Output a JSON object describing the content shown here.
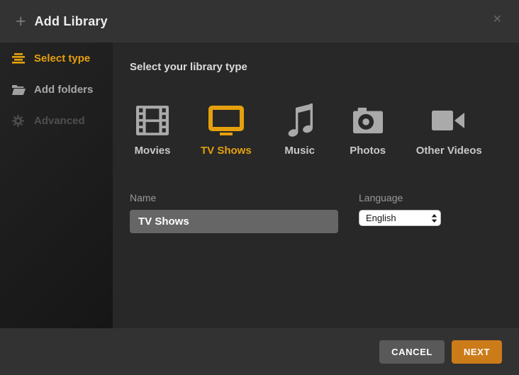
{
  "header": {
    "title": "Add Library",
    "close_glyph": "✕"
  },
  "sidebar": {
    "items": [
      {
        "label": "Select type",
        "state": "active"
      },
      {
        "label": "Add folders",
        "state": "enabled"
      },
      {
        "label": "Advanced",
        "state": "disabled"
      }
    ]
  },
  "main": {
    "heading": "Select your library type",
    "library_types": [
      {
        "label": "Movies",
        "selected": false
      },
      {
        "label": "TV Shows",
        "selected": true
      },
      {
        "label": "Music",
        "selected": false
      },
      {
        "label": "Photos",
        "selected": false
      },
      {
        "label": "Other Videos",
        "selected": false
      }
    ],
    "name_field": {
      "label": "Name",
      "value": "TV Shows"
    },
    "language_field": {
      "label": "Language",
      "value": "English"
    }
  },
  "footer": {
    "cancel_label": "CANCEL",
    "next_label": "NEXT"
  },
  "colors": {
    "accent_yellow": "#e5a00d",
    "accent_orange": "#cc7b19",
    "header_bg": "#333333",
    "content_bg": "#282828",
    "footer_bg": "#323232"
  }
}
